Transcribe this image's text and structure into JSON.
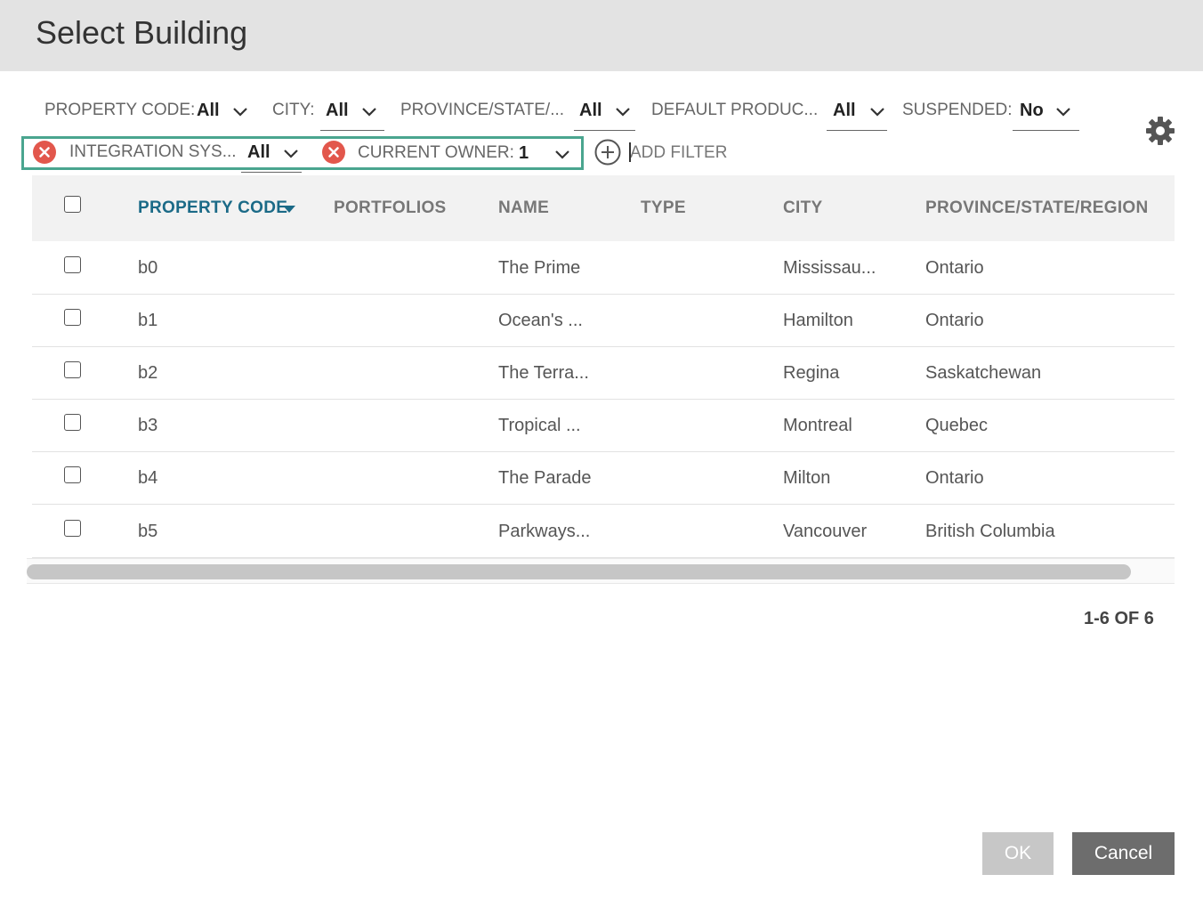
{
  "dialog": {
    "title": "Select Building"
  },
  "filters": {
    "property_code": {
      "label": "PROPERTY CODE:",
      "value": "All"
    },
    "city": {
      "label": "CITY:",
      "value": "All"
    },
    "province": {
      "label": "PROVINCE/STATE/...",
      "value": "All"
    },
    "default_product": {
      "label": "DEFAULT PRODUC...",
      "value": "All"
    },
    "suspended": {
      "label": "SUSPENDED:",
      "value": "No"
    },
    "integration_system": {
      "label": "INTEGRATION SYS...",
      "value": "All"
    },
    "current_owner": {
      "label": "CURRENT OWNER:",
      "value": "1"
    },
    "add_filter_label": "ADD FILTER"
  },
  "table": {
    "columns": [
      "PROPERTY CODE",
      "PORTFOLIOS",
      "NAME",
      "TYPE",
      "CITY",
      "PROVINCE/STATE/REGION"
    ],
    "rows": [
      {
        "code": "b0",
        "portfolios": "",
        "name": "The Prime",
        "type": "",
        "city": "Mississau...",
        "province": "Ontario"
      },
      {
        "code": "b1",
        "portfolios": "",
        "name": "Ocean's ...",
        "type": "",
        "city": "Hamilton",
        "province": "Ontario"
      },
      {
        "code": "b2",
        "portfolios": "",
        "name": "The Terra...",
        "type": "",
        "city": "Regina",
        "province": "Saskatchewan"
      },
      {
        "code": "b3",
        "portfolios": "",
        "name": "Tropical ...",
        "type": "",
        "city": "Montreal",
        "province": "Quebec"
      },
      {
        "code": "b4",
        "portfolios": "",
        "name": "The Parade",
        "type": "",
        "city": "Milton",
        "province": "Ontario"
      },
      {
        "code": "b5",
        "portfolios": "",
        "name": "Parkways...",
        "type": "",
        "city": "Vancouver",
        "province": "British Columbia"
      }
    ]
  },
  "pagination": {
    "text": "1-6 OF 6"
  },
  "buttons": {
    "ok": "OK",
    "cancel": "Cancel"
  },
  "colors": {
    "accent": "#1b6a87",
    "highlight": "#4aa58f",
    "remove": "#e2574c"
  }
}
